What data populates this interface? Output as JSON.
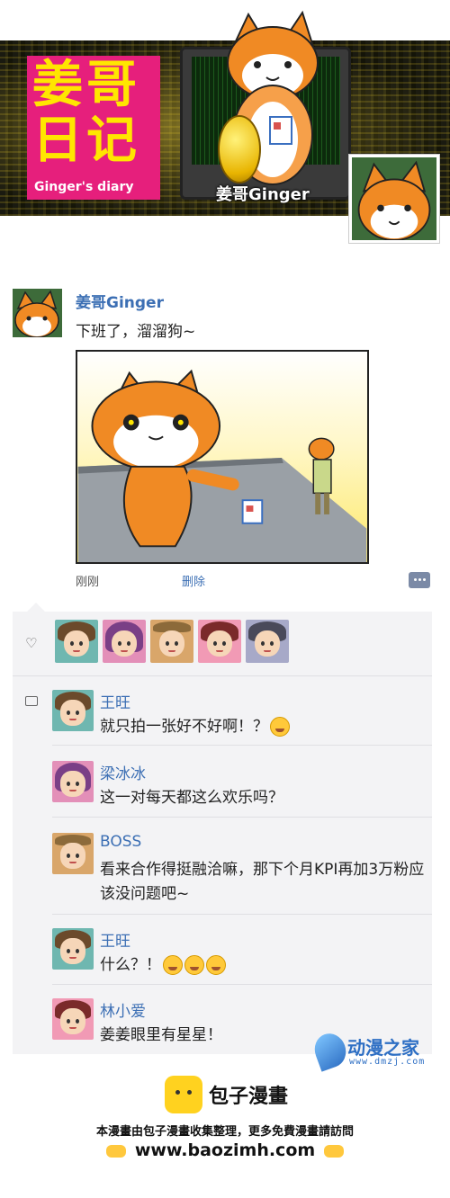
{
  "banner": {
    "logo_title": "姜哥日记",
    "logo_subtitle": "Ginger's diary",
    "name_label": "姜哥Ginger"
  },
  "post": {
    "author": "姜哥Ginger",
    "text": "下班了，溜溜狗~",
    "time": "刚刚",
    "delete_label": "删除"
  },
  "likes": {
    "icon": "heart-icon",
    "count_avatars": 5
  },
  "comments": [
    {
      "name": "王旺",
      "text": "就只拍一张好不好啊！？",
      "emojis": 1
    },
    {
      "name": "梁冰冰",
      "text": "这一对每天都这么欢乐吗？",
      "emojis": 0
    },
    {
      "name": "BOSS",
      "text": "看来合作得挺融洽嘛，那下个月KPI再加3万粉应该没问题吧~",
      "emojis": 0
    },
    {
      "name": "王旺",
      "text": "什么？！",
      "emojis": 3
    },
    {
      "name": "林小爱",
      "text": "姜姜眼里有星星！",
      "emojis": 0
    }
  ],
  "watermark": {
    "name": "动漫之家",
    "url": "www.dmzj.com"
  },
  "footer": {
    "title": "包子漫畫",
    "note": "本漫畫由包子漫畫收集整理，更多免費漫畫請訪問",
    "url": "www.baozimh.com"
  },
  "colors": {
    "link_blue": "#3c6fb4",
    "logo_pink": "#e61f7c",
    "logo_yellow": "#ffe600",
    "panel_bg": "#f3f3f5"
  }
}
